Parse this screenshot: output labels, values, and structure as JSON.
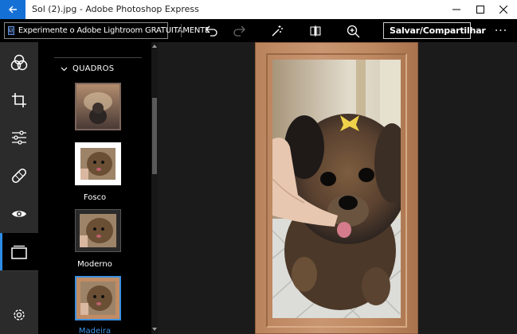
{
  "window": {
    "title": "Sol (2).jpg - Adobe Photoshop Express"
  },
  "toolbar": {
    "lightroom_promo": "Experimente o Adobe Lightroom GRATUITAMENTE",
    "lr_badge": "Lr",
    "save_label": "Salvar/Compartilhar",
    "more_label": "···"
  },
  "rail": {
    "items": [
      "looks",
      "crop",
      "adjustments",
      "healing",
      "eye",
      "frames",
      "settings"
    ],
    "active": "frames"
  },
  "panel": {
    "section_title": "QUADROS",
    "frames": [
      {
        "label": ""
      },
      {
        "label": "Fosco"
      },
      {
        "label": "Moderno"
      },
      {
        "label": "Madeira",
        "selected": true
      }
    ]
  },
  "colors": {
    "accent": "#2d8ce6",
    "titlebar_back": "#1570d6",
    "frame_wood": "#c99672"
  }
}
